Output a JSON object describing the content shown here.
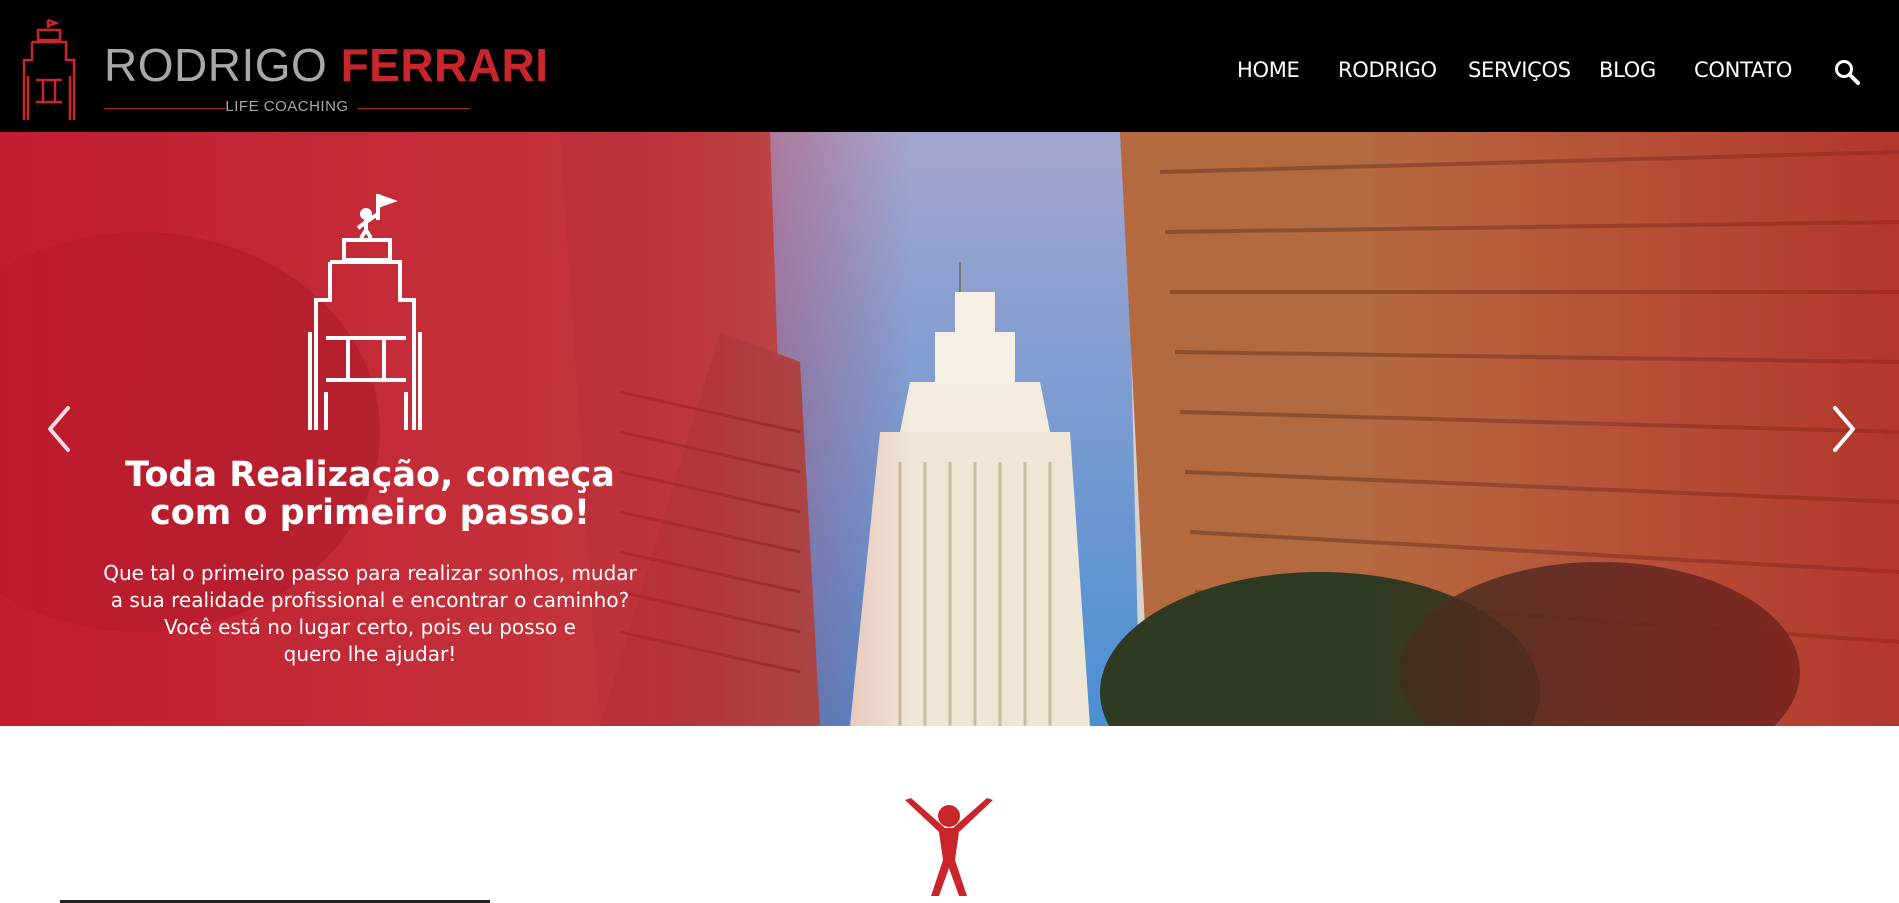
{
  "header": {
    "logo": {
      "first_name": "RODRIGO",
      "last_name": "FERRARI",
      "tagline": "LIFE COACHING",
      "brand_color": "#c9262c"
    },
    "nav": [
      {
        "label": "HOME"
      },
      {
        "label": "RODRIGO"
      },
      {
        "label": "SERVIÇOS"
      },
      {
        "label": "BLOG"
      },
      {
        "label": "CONTATO"
      }
    ],
    "search_icon": "search-icon"
  },
  "hero": {
    "title_line1": "Toda Realização, começa",
    "title_line2": "com o primeiro passo!",
    "text_line1": "Que tal o primeiro passo para realizar sonhos, mudar",
    "text_line2": "a sua realidade profissional e encontrar o caminho?",
    "text_line3": "Você está no lugar certo, pois eu posso e",
    "text_line4": "quero lhe ajudar!",
    "prev_icon": "chevron-left-icon",
    "next_icon": "chevron-right-icon"
  },
  "colors": {
    "header_bg": "#000000",
    "accent_red": "#c9262c",
    "text_light": "#ffffff"
  }
}
